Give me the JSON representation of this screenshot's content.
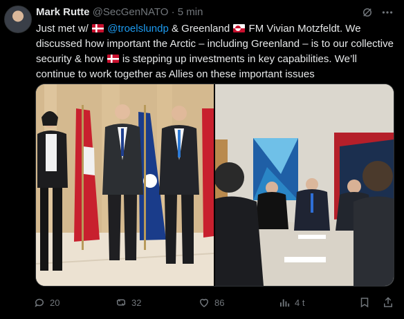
{
  "post": {
    "author_name": "Mark Rutte",
    "author_handle": "@SecGenNATO",
    "separator": "·",
    "timestamp": "5 min",
    "text_1": "Just met w/ ",
    "mention": "@troelslundp",
    "text_2": " & Greenland ",
    "text_3": " FM Vivian Motzfeldt. We discussed how important the Arctic – including Greenland – is to our collective security & how ",
    "text_4": " is stepping up investments in key capabilities. We’ll continue to work together as Allies on these important issues"
  },
  "media": {
    "left_photo": "photo-left",
    "right_photo": "photo-right"
  },
  "actions": {
    "replies": "20",
    "reposts": "32",
    "likes": "86",
    "views": "4 t"
  },
  "icons": {
    "header": [
      "grok-icon",
      "more-icon"
    ],
    "actions": [
      "reply-icon",
      "repost-icon",
      "like-icon",
      "views-icon",
      "bookmark-icon",
      "share-icon"
    ]
  },
  "colors": {
    "background": "#000000",
    "text_primary": "#e7e9ea",
    "text_secondary": "#71767b",
    "accent": "#1d9bf0",
    "border": "#2f3336"
  }
}
